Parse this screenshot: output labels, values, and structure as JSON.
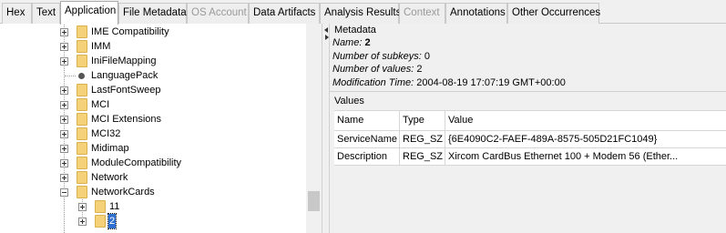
{
  "tabs": [
    {
      "label": "Hex",
      "state": "normal"
    },
    {
      "label": "Text",
      "state": "normal"
    },
    {
      "label": "Application",
      "state": "active"
    },
    {
      "label": "File Metadata",
      "state": "normal"
    },
    {
      "label": "OS Account",
      "state": "disabled"
    },
    {
      "label": "Data Artifacts",
      "state": "normal"
    },
    {
      "label": "Analysis Results",
      "state": "normal"
    },
    {
      "label": "Context",
      "state": "disabled"
    },
    {
      "label": "Annotations",
      "state": "normal"
    },
    {
      "label": "Other Occurrences",
      "state": "normal"
    }
  ],
  "tree": {
    "items": [
      {
        "label": "IME Compatibility",
        "toggle": "plus",
        "kind": "folder"
      },
      {
        "label": "IMM",
        "toggle": "plus",
        "kind": "folder"
      },
      {
        "label": "IniFileMapping",
        "toggle": "plus",
        "kind": "folder"
      },
      {
        "label": "LanguagePack",
        "toggle": "none",
        "kind": "leaf"
      },
      {
        "label": "LastFontSweep",
        "toggle": "plus",
        "kind": "folder"
      },
      {
        "label": "MCI",
        "toggle": "plus",
        "kind": "folder"
      },
      {
        "label": "MCI Extensions",
        "toggle": "plus",
        "kind": "folder"
      },
      {
        "label": "MCI32",
        "toggle": "plus",
        "kind": "folder"
      },
      {
        "label": "Midimap",
        "toggle": "plus",
        "kind": "folder"
      },
      {
        "label": "ModuleCompatibility",
        "toggle": "plus",
        "kind": "folder"
      },
      {
        "label": "Network",
        "toggle": "plus",
        "kind": "folder"
      },
      {
        "label": "NetworkCards",
        "toggle": "minus",
        "kind": "folder"
      },
      {
        "label": "11",
        "toggle": "plus",
        "kind": "folder",
        "child": true
      },
      {
        "label": "2",
        "toggle": "plus",
        "kind": "folder",
        "child": true,
        "selected": true
      }
    ]
  },
  "metadata": {
    "section_title": "Metadata",
    "name_key": "Name:",
    "name_value": "2",
    "subkeys_key": "Number of subkeys:",
    "subkeys_value": "0",
    "values_key": "Number of values:",
    "values_value": "2",
    "mod_key": "Modification Time:",
    "mod_value": "2004-08-19 17:07:19 GMT+00:00"
  },
  "values": {
    "section_title": "Values",
    "columns": [
      "Name",
      "Type",
      "Value"
    ],
    "rows": [
      {
        "name": "ServiceName",
        "type": "REG_SZ",
        "value": "{6E4090C2-FAEF-489A-8575-505D21FC1049}"
      },
      {
        "name": "Description",
        "type": "REG_SZ",
        "value": "Xircom CardBus Ethernet 100 + Modem 56 (Ether..."
      }
    ]
  },
  "colors": {
    "selection": "#2f6fcf",
    "folder": "#f5d279",
    "panel_bg": "#f0f0f0"
  }
}
